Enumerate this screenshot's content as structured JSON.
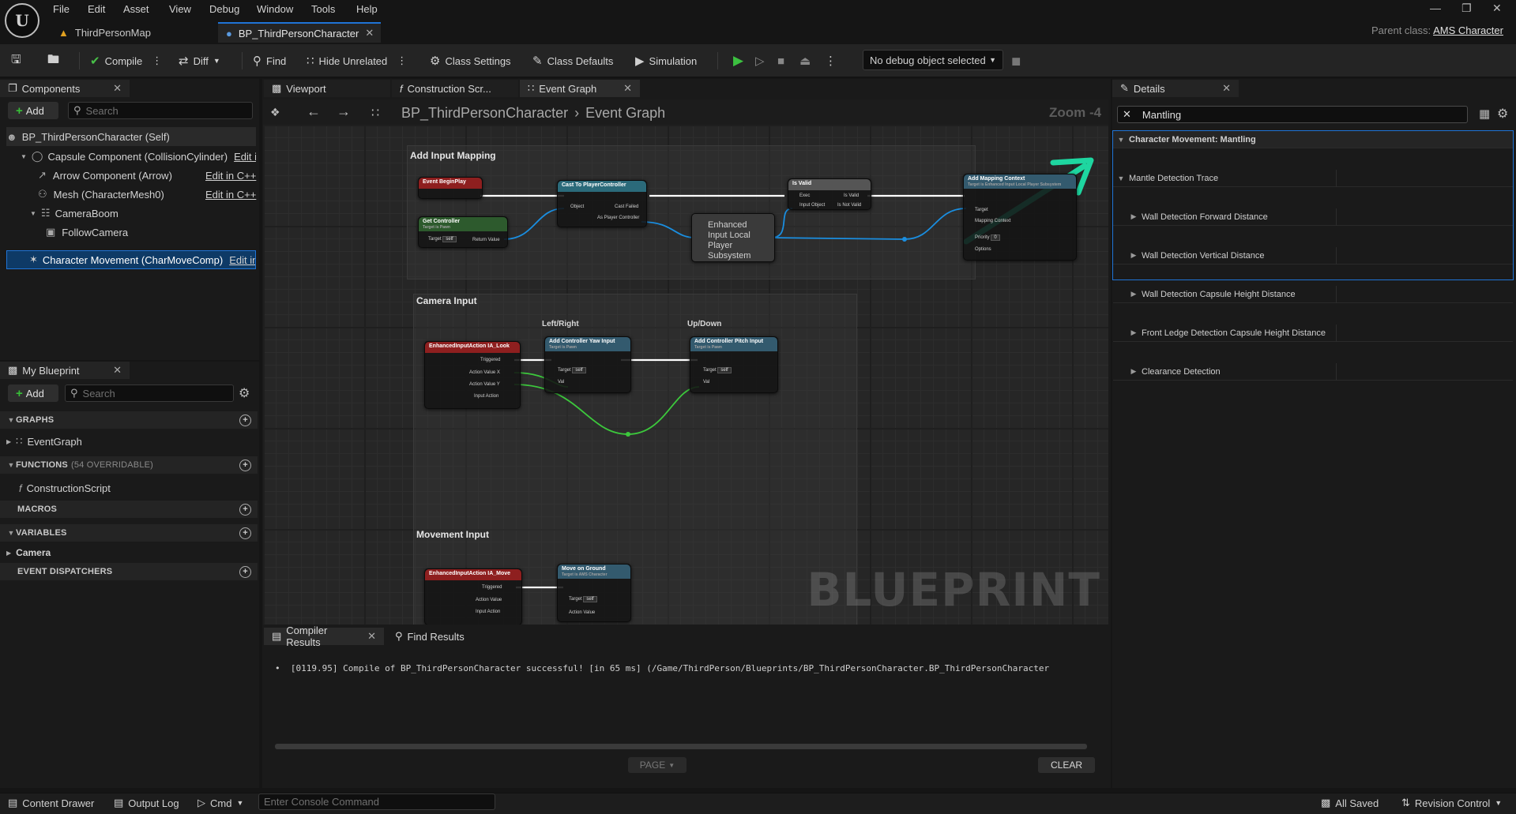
{
  "menu": [
    "File",
    "Edit",
    "Asset",
    "View",
    "Debug",
    "Window",
    "Tools",
    "Help"
  ],
  "tabs": [
    {
      "label": "ThirdPersonMap",
      "active": false
    },
    {
      "label": "BP_ThirdPersonCharacter",
      "active": true
    }
  ],
  "parent_class": {
    "label": "Parent class:",
    "value": "AMS Character"
  },
  "toolbar": {
    "compile": "Compile",
    "diff": "Diff",
    "find": "Find",
    "hide_unrelated": "Hide Unrelated",
    "class_settings": "Class Settings",
    "class_defaults": "Class Defaults",
    "simulation": "Simulation",
    "debug_object": "No debug object selected"
  },
  "components": {
    "tab": "Components",
    "add": "Add",
    "search_placeholder": "Search",
    "items": [
      {
        "label": "BP_ThirdPersonCharacter (Self)",
        "edit": ""
      },
      {
        "label": "Capsule Component (CollisionCylinder)",
        "edit": "Edit in"
      },
      {
        "label": "Arrow Component (Arrow)",
        "edit": "Edit in C++"
      },
      {
        "label": "Mesh (CharacterMesh0)",
        "edit": "Edit in C++"
      },
      {
        "label": "CameraBoom",
        "edit": ""
      },
      {
        "label": "FollowCamera",
        "edit": ""
      },
      {
        "label": "Character Movement (CharMoveComp)",
        "edit": "Edit in"
      }
    ]
  },
  "my_blueprint": {
    "tab": "My Blueprint",
    "add": "Add",
    "search_placeholder": "Search",
    "graphs_header": "GRAPHS",
    "graph_item": "EventGraph",
    "functions_header": "FUNCTIONS",
    "functions_sub": "(54 OVERRIDABLE)",
    "function_item": "ConstructionScript",
    "macros_header": "MACROS",
    "variables_header": "VARIABLES",
    "variable_item": "Camera",
    "dispatchers_header": "EVENT DISPATCHERS"
  },
  "editor_tabs": [
    "Viewport",
    "Construction Scr...",
    "Event Graph"
  ],
  "breadcrumb": {
    "root": "BP_ThirdPersonCharacter",
    "current": "Event Graph",
    "zoom": "Zoom -4"
  },
  "graph": {
    "watermark": "BLUEPRINT",
    "comments": [
      "Add Input Mapping",
      "Camera Input",
      "Movement Input"
    ],
    "mini_labels": [
      "Left/Right",
      "Up/Down"
    ],
    "nodes": {
      "begin_play": "Event BeginPlay",
      "get_controller": "Get Controller",
      "get_controller_sub": "Target is Pawn",
      "cast": "Cast To PlayerController",
      "is_valid": "Is Valid",
      "add_mapping": "Add Mapping Context",
      "add_mapping_sub": "Target is Enhanced Input Local Player Subsystem",
      "subsystem": "Enhanced Input Local Player Subsystem",
      "look": "EnhancedInputAction IA_Look",
      "yaw": "Add Controller Yaw Input",
      "pitch": "Add Controller Pitch Input",
      "target_pawn": "Target is Pawn",
      "move": "EnhancedInputAction IA_Move",
      "move_ground": "Move on Ground",
      "move_ground_sub": "Target is AMS Character"
    },
    "pins": {
      "target": "Target",
      "self": "self",
      "return_value": "Return Value",
      "object": "Object",
      "cast_failed": "Cast Failed",
      "as_player_controller": "As Player Controller",
      "exec": "Exec",
      "input_object": "Input Object",
      "is_valid": "Is Valid",
      "is_not_valid": "Is Not Valid",
      "mapping_context": "Mapping Context",
      "priority": "Priority",
      "priority_val": "0",
      "options": "Options",
      "triggered": "Triggered",
      "action_value_x": "Action Value X",
      "action_value_y": "Action Value Y",
      "action_value": "Action Value",
      "input_action": "Input Action",
      "val": "Val"
    }
  },
  "compiler": {
    "tab_results": "Compiler Results",
    "tab_find": "Find Results",
    "message": "[0119.95] Compile of BP_ThirdPersonCharacter successful! [in 65 ms] (/Game/ThirdPerson/Blueprints/BP_ThirdPersonCharacter.BP_ThirdPersonCharacter",
    "page": "PAGE",
    "clear": "CLEAR"
  },
  "details": {
    "tab": "Details",
    "search_value": "Mantling",
    "category": "Character Movement: Mantling",
    "group": "Mantle Detection Trace",
    "rows": [
      "Wall Detection Forward Distance",
      "Wall Detection Vertical Distance",
      "Wall Detection Capsule Height Distance",
      "Front Ledge Detection Capsule Height Distance",
      "Clearance Detection"
    ]
  },
  "statusbar": {
    "content_drawer": "Content Drawer",
    "output_log": "Output Log",
    "cmd": "Cmd",
    "console_placeholder": "Enter Console Command",
    "all_saved": "All Saved",
    "revision_control": "Revision Control"
  },
  "colors": {
    "accent_blue": "#1f74d6",
    "event_red": "#8e1f1f",
    "function_blue": "#335a6e",
    "pure_green": "#2d5a2d",
    "annotation_green": "#1ed6a0"
  }
}
